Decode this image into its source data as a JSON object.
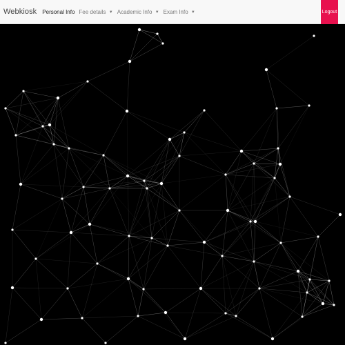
{
  "navbar": {
    "brand": "Webkiosk",
    "items": [
      {
        "label": "Personal Info",
        "name": "nav-personal-info",
        "dropdown": false,
        "active": true
      },
      {
        "label": "Fee details",
        "name": "nav-fee-details",
        "dropdown": true,
        "active": false
      },
      {
        "label": "Academic Info",
        "name": "nav-academic-info",
        "dropdown": true,
        "active": false
      },
      {
        "label": "Exam Info",
        "name": "nav-exam-info",
        "dropdown": true,
        "active": false
      }
    ],
    "logout_label": "Logout"
  },
  "colors": {
    "background": "#000000",
    "navbar": "#f8f8f8",
    "logout": "#e8114e",
    "network": "#ffffff"
  }
}
